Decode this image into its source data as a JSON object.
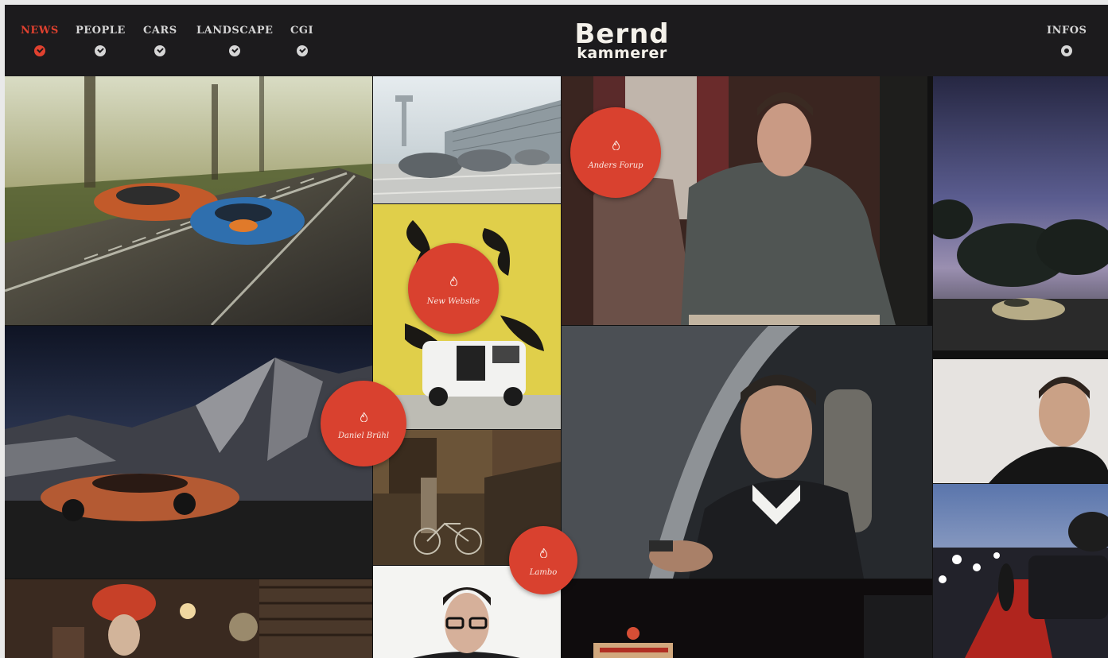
{
  "nav": {
    "items": [
      {
        "label": "NEWS",
        "active": true
      },
      {
        "label": "PEOPLE",
        "active": false
      },
      {
        "label": "CARS",
        "active": false
      },
      {
        "label": "LANDSCAPE",
        "active": false
      },
      {
        "label": "CGI",
        "active": false
      }
    ],
    "infos_label": "INFOS"
  },
  "brand": {
    "line1": "Bernd",
    "line2": "kammerer"
  },
  "badges": [
    {
      "label": "Anders Forup",
      "icon": "flame-icon"
    },
    {
      "label": "New Website",
      "icon": "flame-icon"
    },
    {
      "label": "Daniel Brühl",
      "icon": "flame-icon"
    },
    {
      "label": "Lambo",
      "icon": "flame-icon"
    }
  ],
  "photos": [
    "mclaren-racing-cars-forest-road",
    "bmw-i3-airport",
    "man-in-armchair-portrait",
    "roadster-under-trees-at-dusk",
    "yellow-wall-white-van",
    "lamborghini-mountain-night",
    "street-with-bicycle",
    "man-driving-car-portrait",
    "smiling-man-portrait",
    "red-carpet-paparazzi",
    "costumed-characters-in-bar",
    "man-with-glasses-portrait",
    "neon-sign-at-night"
  ],
  "colors": {
    "accent": "#d9412f",
    "header_bg": "#1c1b1d",
    "nav_text": "#d6d6d6"
  }
}
